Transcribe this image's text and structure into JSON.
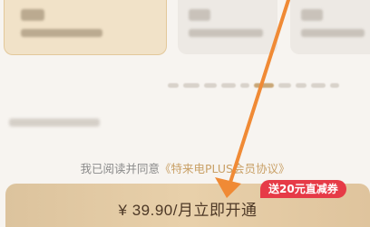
{
  "agreement": {
    "prefix": "我已阅读并同意",
    "link_label": "《特来电PLUS会员协议》"
  },
  "cta": {
    "label": "¥ 39.90/月立即开通",
    "badge": "送20元直减券"
  },
  "annotation": {
    "arrow_color": "#f08a35"
  }
}
